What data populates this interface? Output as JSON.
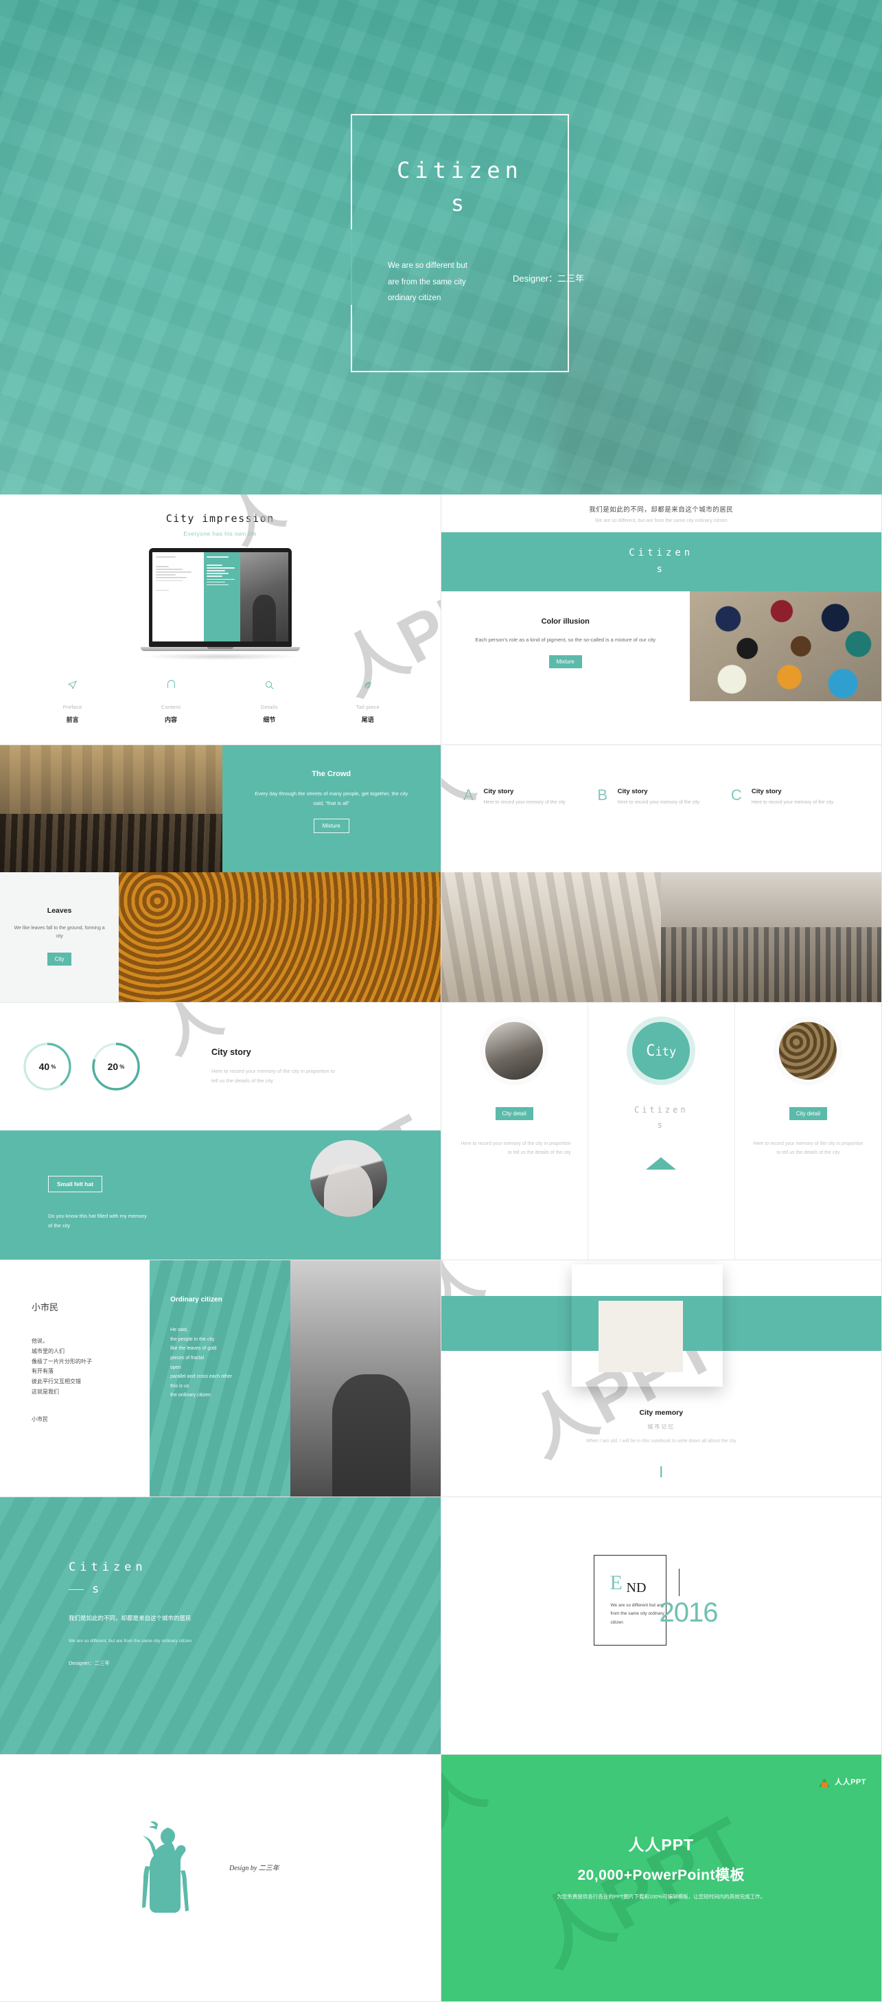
{
  "hero": {
    "title_line1": "Citizen",
    "title_line2": "s",
    "subtitle": "We are so different but are from the same city ordinary citizen",
    "designer": "Designer：二三年"
  },
  "slide1": {
    "title": "City impression",
    "subtitle": "Everyone has his own life",
    "items": [
      {
        "icon": "send-icon",
        "en": "Preface",
        "cn": "前言"
      },
      {
        "icon": "bridge-icon",
        "en": "Content",
        "cn": "内容"
      },
      {
        "icon": "search-icon",
        "en": "Details",
        "cn": "细节"
      },
      {
        "icon": "leaf-icon",
        "en": "Tail piece",
        "cn": "尾语"
      }
    ]
  },
  "slide2": {
    "headline_cn": "我们是如此的不同，却都是来自这个城市的居民",
    "headline_en": "We are so different, but are from the same city ordinary citizen",
    "band_line1": "Citizen",
    "band_line2": "s",
    "card_title": "Color illusion",
    "card_text": "Each person's role as a kind of pigment, so the so-called is a mixture of our city",
    "card_button": "Mixture"
  },
  "slide3": {
    "crowd_title": "The Crowd",
    "crowd_text": "Every day through the streets of many people, get together, the city said, \"that is all\"",
    "crowd_button": "Mixture",
    "leaves_title": "Leaves",
    "leaves_text": "We like leaves fall to the ground, forming a city",
    "leaves_button": "City"
  },
  "slide4": {
    "columns": [
      {
        "letter": "A",
        "title": "City story",
        "text": "Here to record your memory of the city"
      },
      {
        "letter": "B",
        "title": "City story",
        "text": "Here to record your memory of the city"
      },
      {
        "letter": "C",
        "title": "City story",
        "text": "Here to record your memory of the city"
      }
    ]
  },
  "slide5": {
    "donuts": [
      {
        "value": 40,
        "label": "40",
        "unit": "%"
      },
      {
        "value": 20,
        "label": "20",
        "unit": "%"
      }
    ],
    "title": "City story",
    "text": "Here to record your memory of the city in proportion to tell us the details of the city",
    "button": "Small felt hat",
    "caption": "Do you know this hat filled with my memory of the city"
  },
  "slide6": {
    "left": {
      "badge": "City detail",
      "text": "Here to record your memory of the city in proportion to tell us the details of the city"
    },
    "middle": {
      "circle_big": "C",
      "circle_rest": "ity",
      "word_line1": "Citizen",
      "word_line2": "s"
    },
    "right": {
      "badge": "City detail",
      "text": "Here to record your memory of the city in proportion to tell us the details of the city"
    }
  },
  "slide7": {
    "cn_title": "小市民",
    "cn_body": "他说，\n城市里的人们\n像极了一片片分形的叶子\n有开有落\n彼此平行又互相交错\n这就是我们",
    "cn_footer": "小市民",
    "en_title": "Ordinary citizen",
    "en_body": "He said,\nthe people in the city\nlike the leaves of gold\npieces of fractal\nopen\nparallel and cross each other\nthis is us\nthe ordinary citizen"
  },
  "slide8": {
    "title": "City memory",
    "subtitle_cn": "城市记忆",
    "text": "When I am old, I will be in this notebook to write down all about the city"
  },
  "slide9": {
    "title_line1": "Citizen",
    "title_line2": "s",
    "cn_text": "我们是如此的不同，却都是来自这个城市的居民",
    "en_text": "We are so different, but are from the same city ordinary citizen",
    "designer": "Designer：二三年"
  },
  "slide10": {
    "end_e": "E",
    "end_nd": "ND",
    "text": "We are so different but are from the same city ordinary citizen",
    "year": "2016"
  },
  "slide11": {
    "design_by": "Design by  二三年"
  },
  "slide12": {
    "brand": "人人PPT",
    "title": "人人PPT",
    "tagline": "20,000+PowerPoint模板",
    "note": "为您免费提供各行各业的PPT图片下载和100%可编辑模板，让您短时间内的高效完成工作。"
  },
  "colors": {
    "teal": "#5cbaaa",
    "teal_light": "#8fcfc3",
    "green": "#3fc878",
    "orange": "#e8821e",
    "dark": "#1b1b1b"
  }
}
